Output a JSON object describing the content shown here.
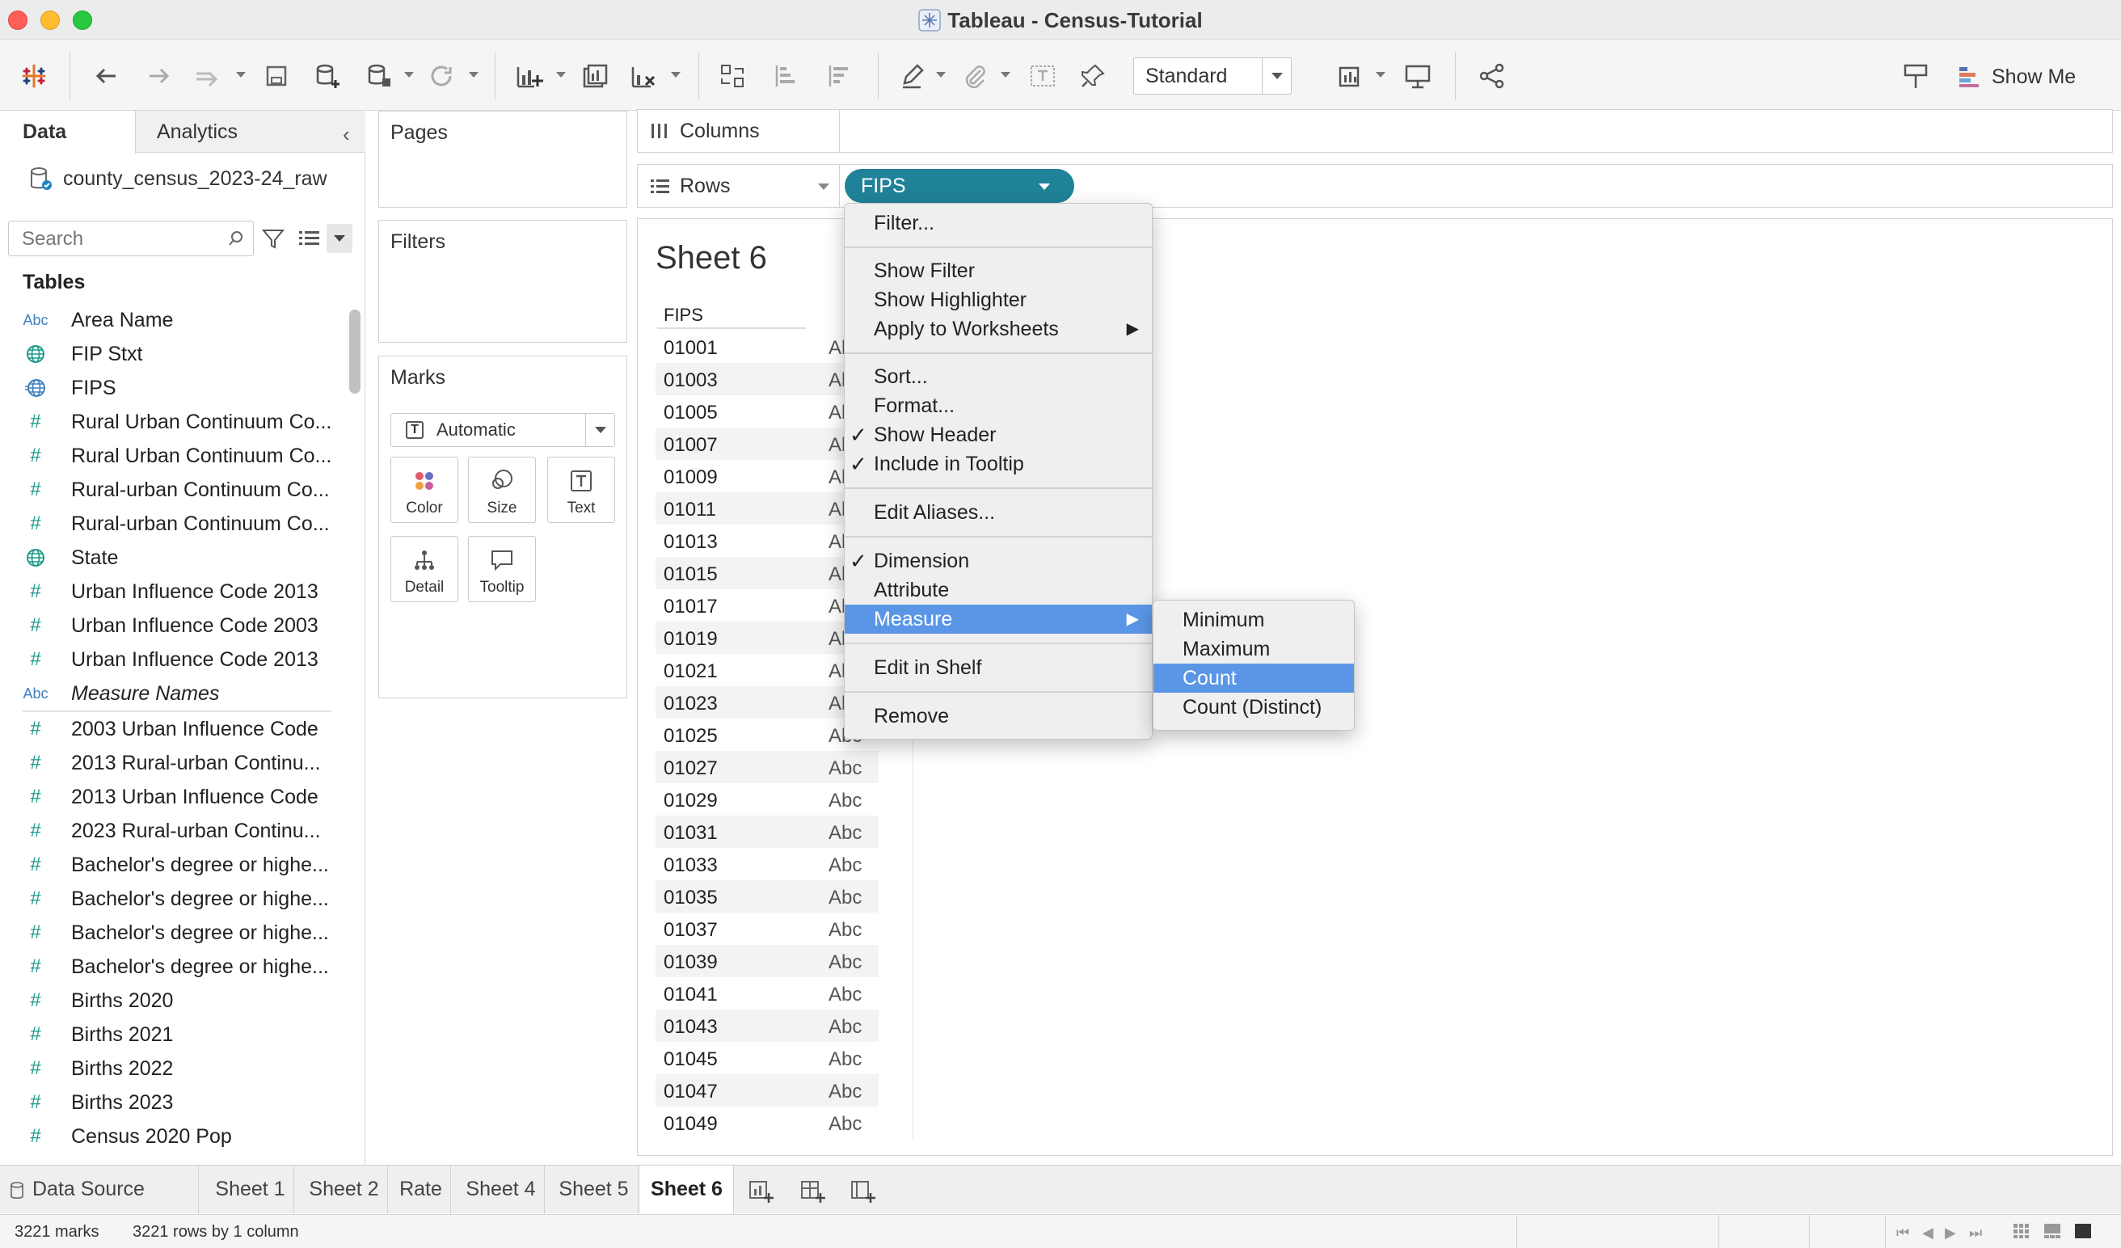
{
  "window": {
    "title": "Tableau - Census-Tutorial"
  },
  "toolbar": {
    "view_size": "Standard",
    "show_me": "Show Me",
    "icons": [
      "tableau-logo-icon",
      "back-icon",
      "forward-icon",
      "redo-icon",
      "save-icon",
      "new-datasource-icon",
      "pause-updates-icon",
      "refresh-icon",
      "new-worksheet-icon",
      "duplicate-sheet-icon",
      "clear-sheet-icon",
      "swap-icon",
      "sort-ascending-icon",
      "sort-descending-icon",
      "highlight-icon",
      "attach-icon",
      "label-icon",
      "pin-icon",
      "fit-icon",
      "presentation-icon",
      "share-icon",
      "tooltip-guide-icon"
    ]
  },
  "data_pane": {
    "tab_data": "Data",
    "tab_analytics": "Analytics",
    "datasource": "county_census_2023-24_raw",
    "search_placeholder": "Search",
    "tables_header": "Tables",
    "fields": [
      {
        "type": "abc",
        "label": "Area Name"
      },
      {
        "type": "geo",
        "label": "FIP Stxt"
      },
      {
        "type": "geo-active",
        "label": "FIPS"
      },
      {
        "type": "num",
        "label": "Rural Urban Continuum Co..."
      },
      {
        "type": "num",
        "label": "Rural Urban Continuum Co..."
      },
      {
        "type": "num",
        "label": "Rural-urban Continuum Co..."
      },
      {
        "type": "num",
        "label": "Rural-urban Continuum Co..."
      },
      {
        "type": "geo",
        "label": "State"
      },
      {
        "type": "num",
        "label": "Urban Influence Code  2013"
      },
      {
        "type": "num",
        "label": "Urban Influence Code 2003"
      },
      {
        "type": "num",
        "label": "Urban Influence Code 2013"
      },
      {
        "type": "abc",
        "label": "Measure Names"
      }
    ],
    "measures": [
      {
        "label": "2003 Urban Influence Code"
      },
      {
        "label": "2013 Rural-urban Continu..."
      },
      {
        "label": "2013 Urban Influence Code"
      },
      {
        "label": "2023 Rural-urban Continu..."
      },
      {
        "label": "Bachelor's degree or highe..."
      },
      {
        "label": "Bachelor's degree or highe..."
      },
      {
        "label": "Bachelor's degree or highe..."
      },
      {
        "label": "Bachelor's degree or highe..."
      },
      {
        "label": "Births 2020"
      },
      {
        "label": "Births 2021"
      },
      {
        "label": "Births 2022"
      },
      {
        "label": "Births 2023"
      },
      {
        "label": "Census 2020 Pop"
      }
    ]
  },
  "cards": {
    "pages": "Pages",
    "filters": "Filters",
    "marks": "Marks",
    "mark_type": "Automatic",
    "mark_buttons": [
      "Color",
      "Size",
      "Text",
      "Detail",
      "Tooltip"
    ]
  },
  "shelves": {
    "columns": "Columns",
    "rows": "Rows",
    "rows_pill": "FIPS"
  },
  "view": {
    "sheet_title": "Sheet 6",
    "column_header": "FIPS",
    "rows": [
      {
        "fips": "01001",
        "abc": "Abc"
      },
      {
        "fips": "01003",
        "abc": "Abc"
      },
      {
        "fips": "01005",
        "abc": "Abc"
      },
      {
        "fips": "01007",
        "abc": "Abc"
      },
      {
        "fips": "01009",
        "abc": "Abc"
      },
      {
        "fips": "01011",
        "abc": "Abc"
      },
      {
        "fips": "01013",
        "abc": "Abc"
      },
      {
        "fips": "01015",
        "abc": "Abc"
      },
      {
        "fips": "01017",
        "abc": "Abc"
      },
      {
        "fips": "01019",
        "abc": "Abc"
      },
      {
        "fips": "01021",
        "abc": "Abc"
      },
      {
        "fips": "01023",
        "abc": "Abc"
      },
      {
        "fips": "01025",
        "abc": "Abc"
      },
      {
        "fips": "01027",
        "abc": "Abc"
      },
      {
        "fips": "01029",
        "abc": "Abc"
      },
      {
        "fips": "01031",
        "abc": "Abc"
      },
      {
        "fips": "01033",
        "abc": "Abc"
      },
      {
        "fips": "01035",
        "abc": "Abc"
      },
      {
        "fips": "01037",
        "abc": "Abc"
      },
      {
        "fips": "01039",
        "abc": "Abc"
      },
      {
        "fips": "01041",
        "abc": "Abc"
      },
      {
        "fips": "01043",
        "abc": "Abc"
      },
      {
        "fips": "01045",
        "abc": "Abc"
      },
      {
        "fips": "01047",
        "abc": "Abc"
      },
      {
        "fips": "01049",
        "abc": "Abc"
      }
    ]
  },
  "context_menu": {
    "filter": "Filter...",
    "show_filter": "Show Filter",
    "show_highlighter": "Show Highlighter",
    "apply_to_worksheets": "Apply to Worksheets",
    "sort": "Sort...",
    "format": "Format...",
    "show_header": "Show Header",
    "include_in_tooltip": "Include in Tooltip",
    "edit_aliases": "Edit Aliases...",
    "dimension": "Dimension",
    "attribute": "Attribute",
    "measure": "Measure",
    "edit_in_shelf": "Edit in Shelf",
    "remove": "Remove",
    "check": "✓",
    "submenu_arrow": "▶"
  },
  "measure_submenu": {
    "minimum": "Minimum",
    "maximum": "Maximum",
    "count": "Count",
    "count_distinct": "Count (Distinct)"
  },
  "sheet_tabs": {
    "data_source": "Data Source",
    "tabs": [
      "Sheet 1",
      "Sheet 2",
      "Rate",
      "Sheet 4",
      "Sheet 5",
      "Sheet 6"
    ],
    "active": "Sheet 6"
  },
  "status": {
    "marks": "3221 marks",
    "rows": "3221 rows by 1 column"
  },
  "colors": {
    "pill": "#1f8298",
    "menu_highlight": "#5b96e6",
    "measure_icon": "#1d9a8a",
    "dimension_icon": "#3f7fbf"
  }
}
